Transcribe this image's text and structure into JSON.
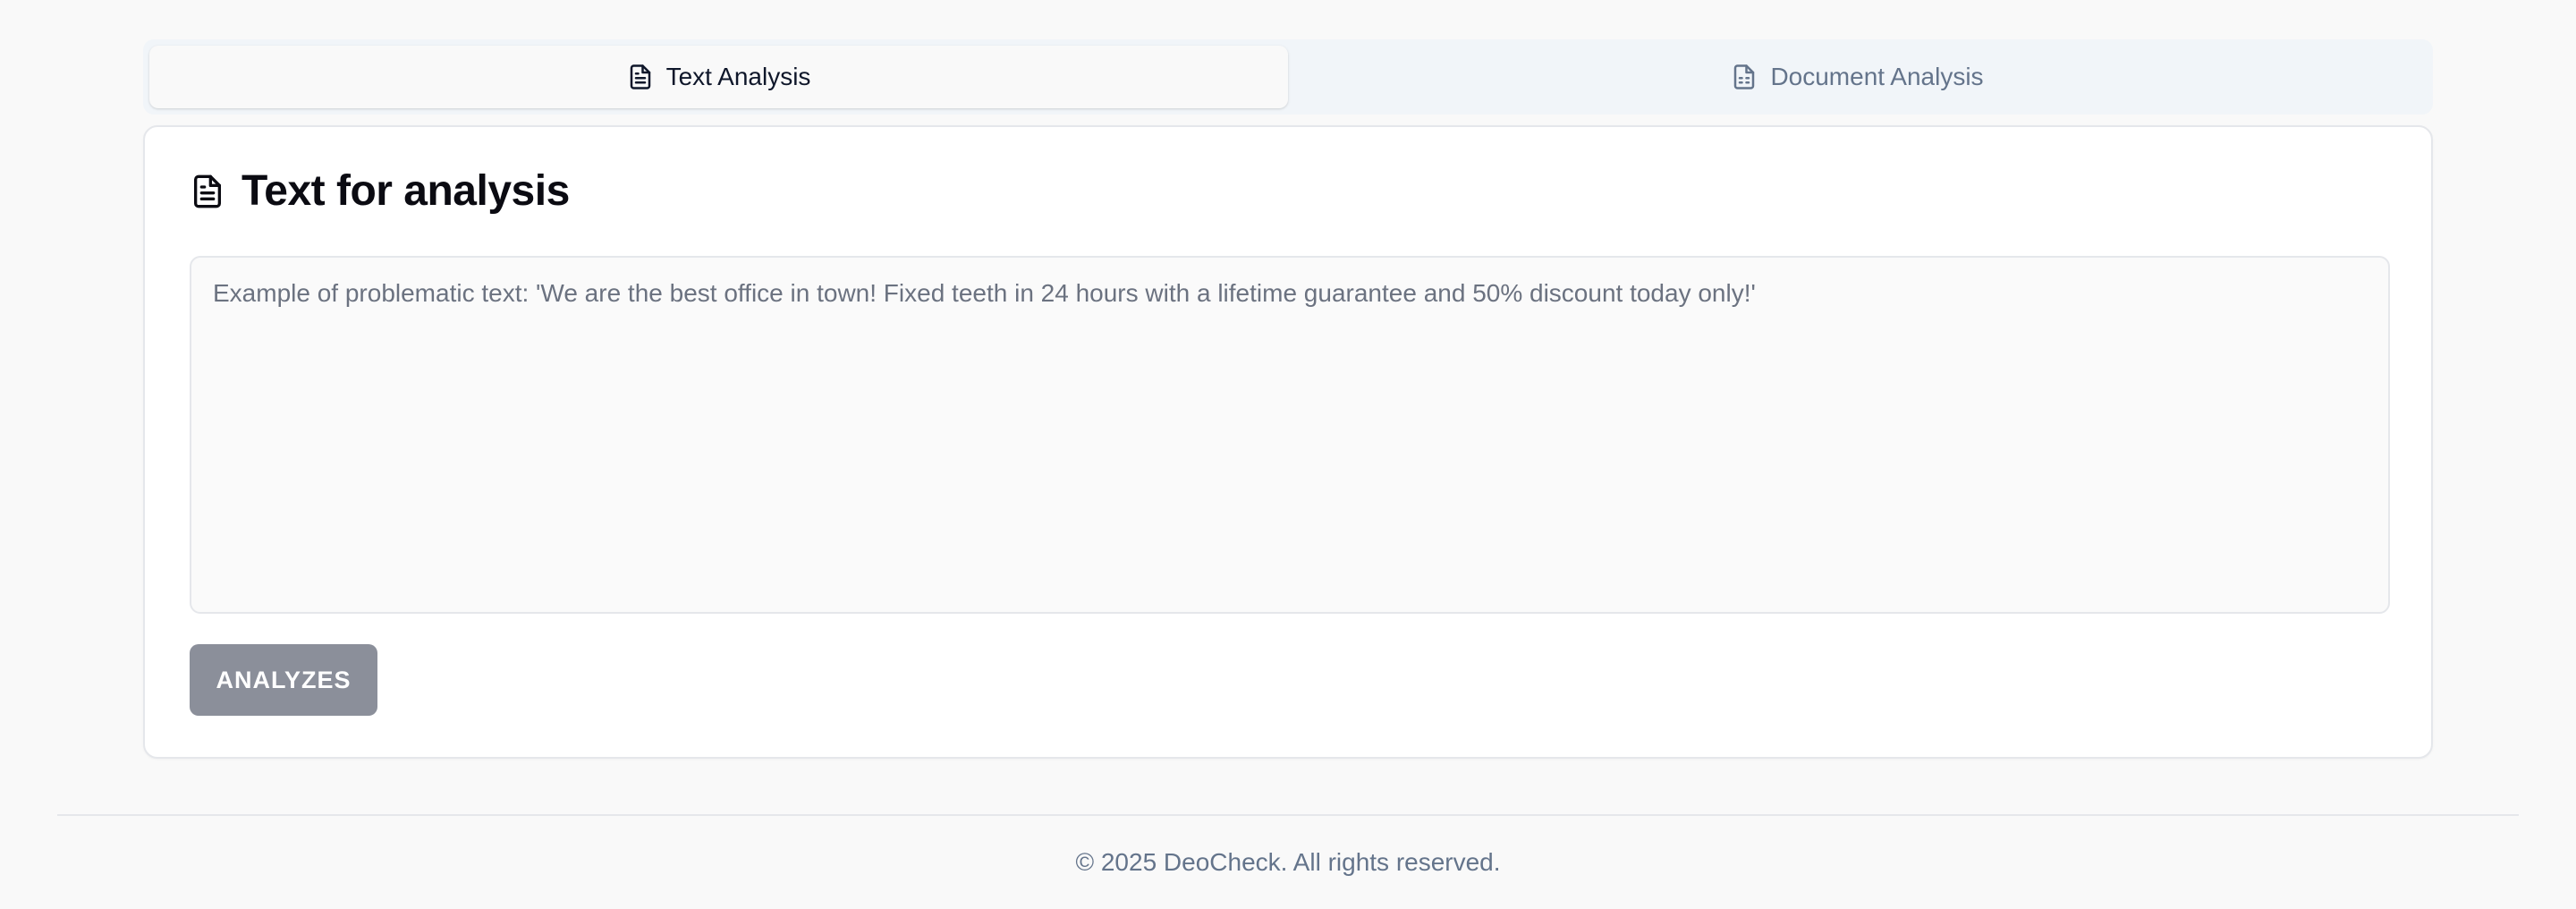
{
  "tabs": [
    {
      "label": "Text Analysis",
      "icon": "file-text-icon",
      "active": true
    },
    {
      "label": "Document Analysis",
      "icon": "file-spreadsheet-icon",
      "active": false
    }
  ],
  "card": {
    "title": "Text for analysis",
    "title_icon": "file-text-icon",
    "textarea": {
      "value": "",
      "placeholder": "Example of problematic text: 'We are the best office in town! Fixed teeth in 24 hours with a lifetime guarantee and 50% discount today only!'"
    },
    "analyze_label": "ANALYZES"
  },
  "footer": {
    "text": "© 2025 DeoCheck. All rights reserved."
  },
  "colors": {
    "page_bg": "#f9f9f9",
    "tab_bar_bg": "#f1f5f9",
    "button_disabled": "#8b8f9a",
    "muted_text": "#64748b"
  }
}
